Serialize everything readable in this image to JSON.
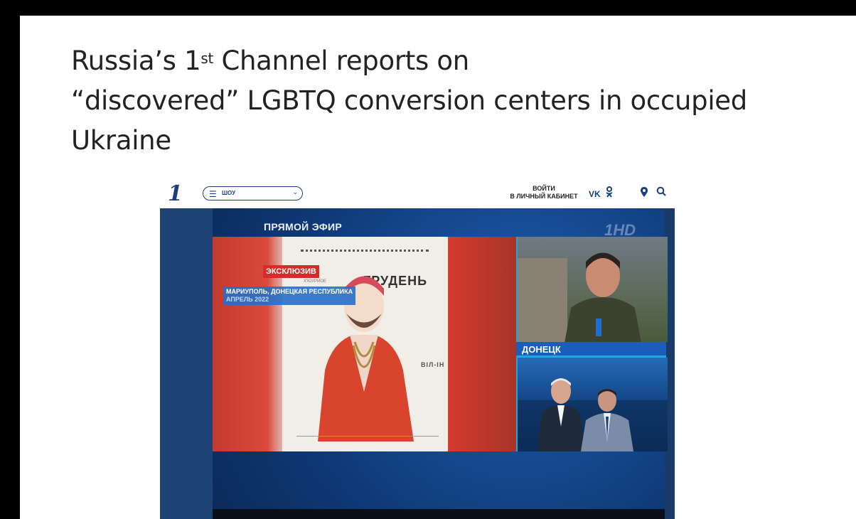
{
  "slide": {
    "title_line1_pre": "Russia’s 1",
    "title_sup": "st",
    "title_line1_post": " Channel reports on",
    "title_line2": "“discovered” LGBTQ conversion centers in occupied",
    "title_line3": "Ukraine"
  },
  "site": {
    "logo": "1",
    "menu_label": "ШОУ",
    "login_line1": "ВОЙТИ",
    "login_line2": "В ЛИЧНЫЙ КАБИНЕТ",
    "vk": "VK",
    "icons": [
      "menu-icon",
      "chevron-down-icon",
      "vk-icon",
      "odnoklassniki-icon",
      "location-pin-icon",
      "search-icon"
    ]
  },
  "broadcast": {
    "live_label": "ПРЯМОЙ ЭФИР",
    "channel_logo": "1HD",
    "exclusive_badge": "ЭКСКЛЮЗИВ",
    "location": "МАРИУПОЛЬ, ДОНЕЦКАЯ РЕСПУБЛИКА",
    "date": "АПРЕЛЬ 2022",
    "calendar_month": "ГРУДЕНЬ",
    "calendar_side_text": "ВІЛ-ІН",
    "calendar_small_text": "Х'ЮУРИОЕ",
    "reporter_caption": "ДОНЕЦК"
  },
  "colors": {
    "brand_blue": "#1a3f7a",
    "exclusive_red": "#d82a2a",
    "caption_blue": "#1b5db9",
    "accent_cyan": "#1ea8e0"
  }
}
